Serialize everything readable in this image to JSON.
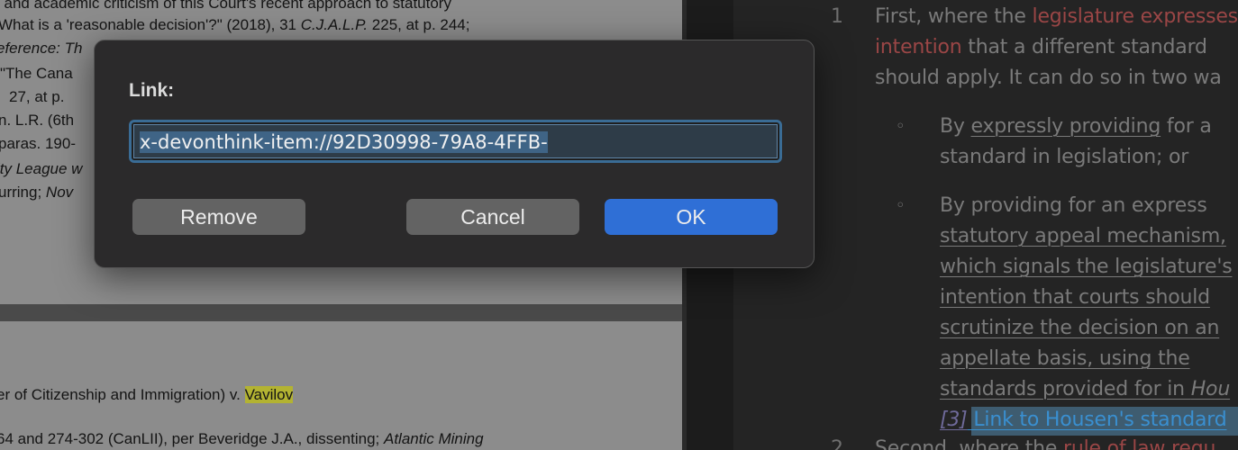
{
  "pdf": {
    "top_lines": [
      {
        "parts": [
          {
            "t": "l and academic criticism of this Court's recent approach to statutory"
          }
        ]
      },
      {
        "parts": [
          {
            "t": "What is a 'reasonable decision'?\" (2018), 31 "
          },
          {
            "t": "C.J.A.L.P.",
            "i": true
          },
          {
            "t": " 225, at p. 244;"
          }
        ]
      },
      {
        "parts": [
          {
            "t": "eference: Th",
            "i": true
          }
        ]
      },
      {
        "parts": [
          {
            "t": "\"The Cana"
          }
        ]
      },
      {
        "parts": [
          {
            "t": "27, at p."
          }
        ]
      },
      {
        "parts": [
          {
            "t": "n. L.R. (6th"
          }
        ]
      },
      {
        "parts": [
          {
            "t": "paras. 190-"
          }
        ]
      },
      {
        "parts": [
          {
            "t": "ity League",
            "i": true
          },
          {
            "t": " w",
            "i": true
          }
        ]
      },
      {
        "parts": [
          {
            "t": "urring; "
          },
          {
            "t": "Nov",
            "i": true
          }
        ]
      }
    ],
    "bottom_lines": [
      {
        "parts": [
          {
            "t": "er of Citizenship and Immigration) v. "
          },
          {
            "t": "Vavilov",
            "hl": true
          }
        ]
      },
      {
        "parts": [
          {
            "t": "64 and 274-302 (CanLII), per Beveridge J.A., dissenting; "
          },
          {
            "t": "Atlantic Mining",
            "i": true
          }
        ]
      }
    ]
  },
  "editor": {
    "item1_number": "1",
    "line1_a": "First, where the ",
    "line1_b": "legislature expresses",
    "line2_a": "intention",
    "line2_b": " that a different standard",
    "line3": "should apply. It can do so in two wa",
    "bullet_symbol": "◦",
    "b1_l1_u": "expressly providing",
    "b1_l1_a": "By ",
    "b1_l1_b": " for a",
    "b1_l2": "standard in legislation; or",
    "b2_l1": "By providing for an express",
    "b2_l2": "statutory appeal mechanism,",
    "b2_l3": "which signals the legislature's",
    "b2_l4": "intention that courts should",
    "b2_l5": "scrutinize the decision on an",
    "b2_l6": "appellate basis, using the",
    "b2_l7_a": "standards provided for in ",
    "b2_l7_b": "Hou",
    "footnote_ref": "[3]",
    "footnote_link": " Link to Housen's standard",
    "item2_number": "2.",
    "item2_a": "Second, where the ",
    "item2_b": "rule of law requ"
  },
  "dialog": {
    "label": "Link:",
    "link_value": "x-devonthink-item://92D30998-79A8-4FFB-",
    "remove_label": "Remove",
    "cancel_label": "Cancel",
    "ok_label": "OK"
  },
  "colors": {
    "accent": "#2f6fd6",
    "highlight": "#b3b332",
    "link_red": "#9a4646"
  }
}
